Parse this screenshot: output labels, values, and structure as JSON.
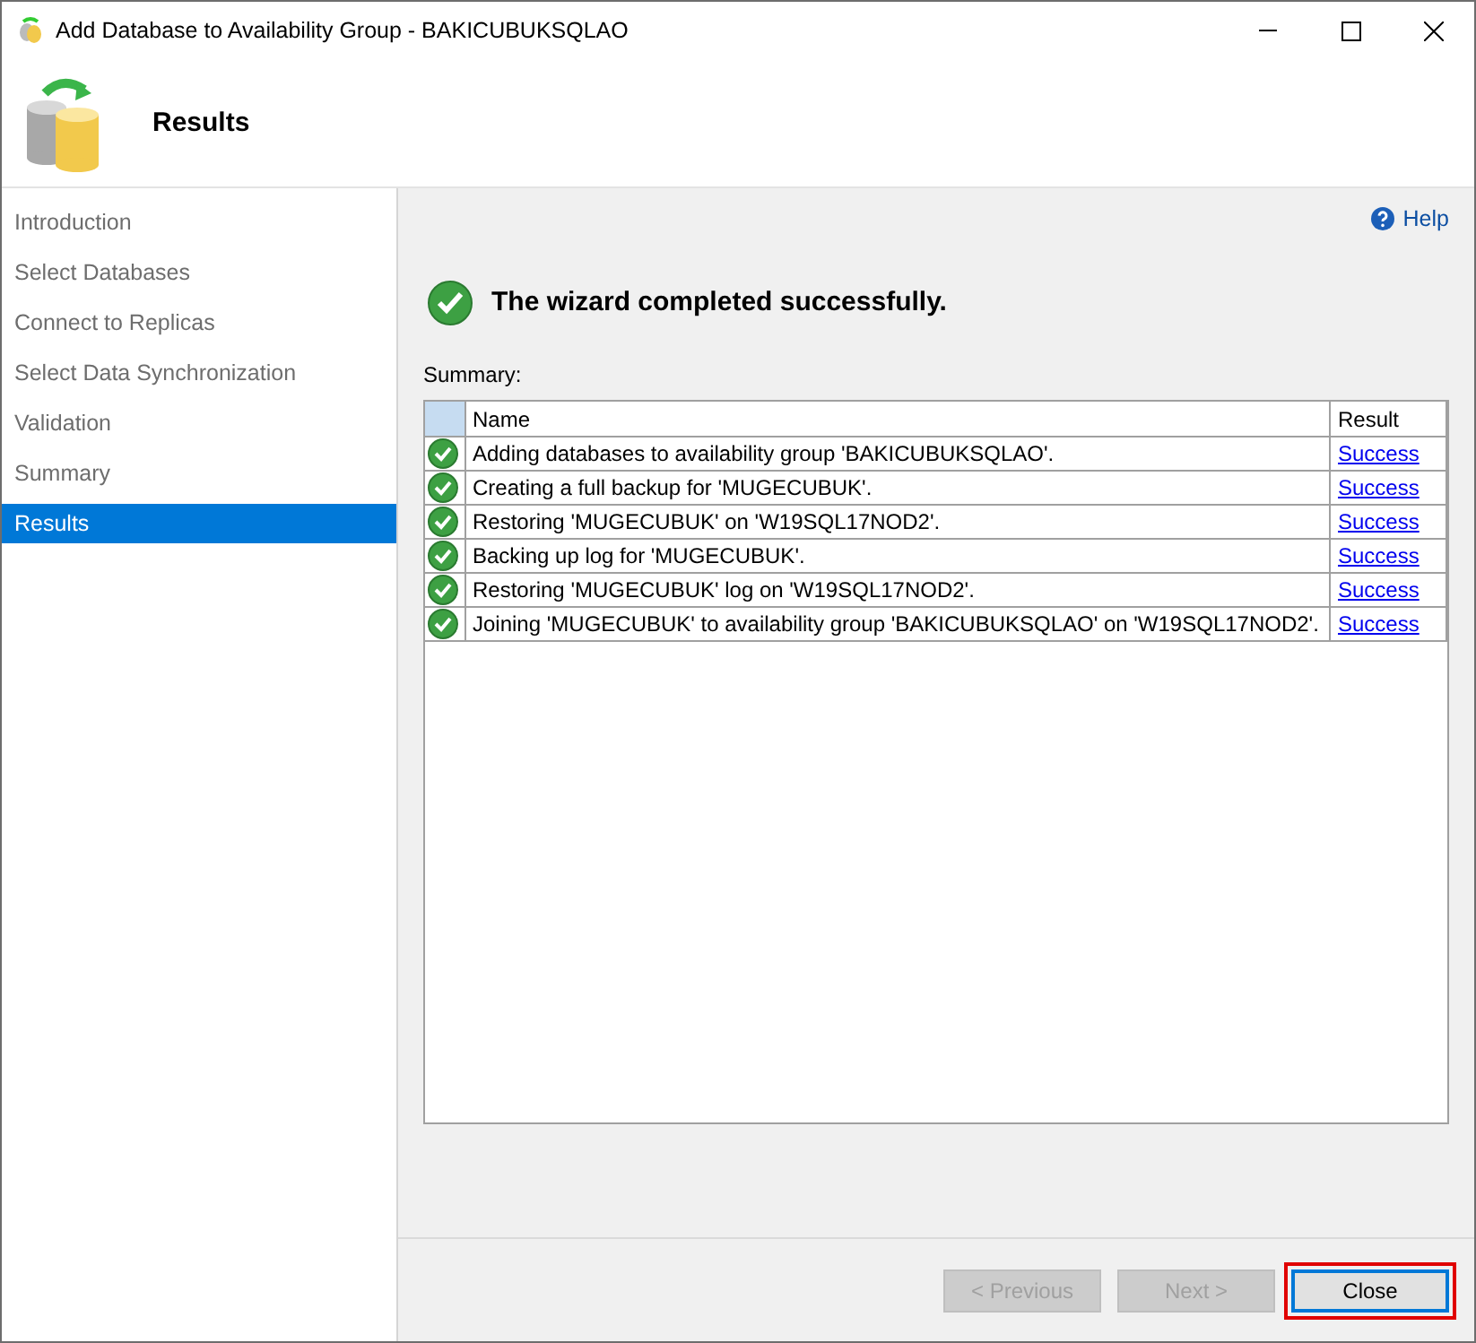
{
  "window": {
    "title": "Add Database to Availability Group - BAKICUBUKSQLAO"
  },
  "header": {
    "title": "Results"
  },
  "sidebar": {
    "items": [
      {
        "label": "Introduction",
        "selected": false
      },
      {
        "label": "Select Databases",
        "selected": false
      },
      {
        "label": "Connect to Replicas",
        "selected": false
      },
      {
        "label": "Select Data Synchronization",
        "selected": false
      },
      {
        "label": "Validation",
        "selected": false
      },
      {
        "label": "Summary",
        "selected": false
      },
      {
        "label": "Results",
        "selected": true
      }
    ]
  },
  "help": "Help",
  "status_message": "The wizard completed successfully.",
  "summary_label": "Summary:",
  "table": {
    "columns": [
      "Name",
      "Result"
    ],
    "rows": [
      {
        "name": "Adding databases to availability group 'BAKICUBUKSQLAO'.",
        "result": "Success"
      },
      {
        "name": "Creating a full backup for 'MUGECUBUK'.",
        "result": "Success"
      },
      {
        "name": "Restoring 'MUGECUBUK' on 'W19SQL17NOD2'.",
        "result": "Success"
      },
      {
        "name": "Backing up log for 'MUGECUBUK'.",
        "result": "Success"
      },
      {
        "name": "Restoring 'MUGECUBUK' log on 'W19SQL17NOD2'.",
        "result": "Success"
      },
      {
        "name": "Joining 'MUGECUBUK' to availability group 'BAKICUBUKSQLAO' on 'W19SQL17NOD2'.",
        "result": "Success"
      }
    ]
  },
  "buttons": [
    {
      "label": "< Previous",
      "disabled": true,
      "focused": false,
      "highlighted": false
    },
    {
      "label": "Next >",
      "disabled": true,
      "focused": false,
      "highlighted": false
    },
    {
      "label": "Close",
      "disabled": false,
      "focused": true,
      "highlighted": true
    }
  ]
}
